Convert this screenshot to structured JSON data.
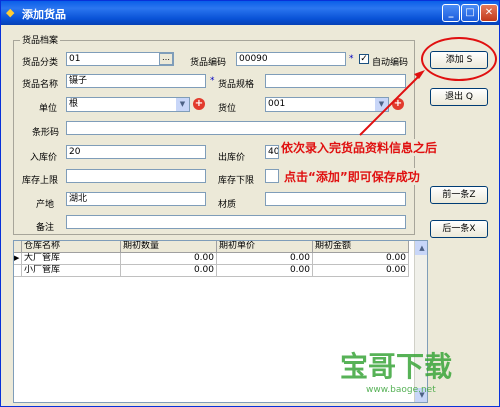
{
  "window": {
    "title": "添加货品"
  },
  "group": {
    "title": "货品档案"
  },
  "form": {
    "category_label": "货品分类",
    "category_value": "01",
    "code_label": "货品编码",
    "code_value": "00090",
    "auto_code_label": "自动编码",
    "name_label": "货品名称",
    "name_value": "镊子",
    "spec_label": "货品规格",
    "spec_value": "",
    "unit_label": "单位",
    "unit_value": "根",
    "location_label": "货位",
    "location_value": "001",
    "barcode_label": "条形码",
    "barcode_value": "",
    "in_price_label": "入库价",
    "in_price_value": "20",
    "out_price_label": "出库价",
    "out_price_value": "40",
    "stock_upper_label": "库存上限",
    "stock_upper_value": "",
    "stock_lower_label": "库存下限",
    "stock_lower_value": "",
    "origin_label": "产地",
    "origin_value": "湖北",
    "material_label": "材质",
    "material_value": "",
    "remark_label": "备注",
    "remark_value": ""
  },
  "buttons": {
    "add": "添加 S",
    "exit": "退出 Q",
    "prev": "前一条Z",
    "next": "后一条X"
  },
  "annotation": {
    "line1": "依次录入完货品资料信息之后",
    "line2": "点击“添加”即可保存成功"
  },
  "grid": {
    "columns": [
      "仓库名称",
      "期初数量",
      "期初单价",
      "期初金额"
    ],
    "rows": [
      {
        "name": "大厂管库",
        "qty": "0.00",
        "price": "0.00",
        "amount": "0.00"
      },
      {
        "name": "小厂管库",
        "qty": "0.00",
        "price": "0.00",
        "amount": "0.00"
      }
    ]
  },
  "watermark": {
    "text": "宝哥下载",
    "url": "www.baoge.net"
  }
}
